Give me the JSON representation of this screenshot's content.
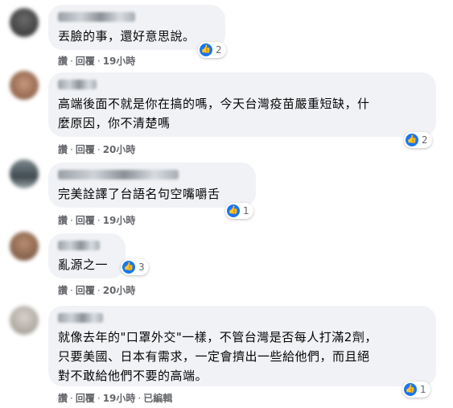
{
  "comments": [
    {
      "text": "丟臉的事，還好意思說。",
      "reaction_count": "2",
      "actions": {
        "like": "讚",
        "reply": "回覆",
        "time": "19小時"
      }
    },
    {
      "text": "高端後面不就是你在搞的嗎，今天台灣疫苗嚴重短缺，什\n麼原因，你不清楚嗎",
      "reaction_count": "2",
      "actions": {
        "like": "讚",
        "reply": "回覆",
        "time": "20小時"
      }
    },
    {
      "text": "完美詮譯了台語名句空嘴嚼舌",
      "reaction_count": "1",
      "actions": {
        "like": "讚",
        "reply": "回覆",
        "time": "19小時"
      }
    },
    {
      "text": "亂源之一",
      "reaction_count": "3",
      "actions": {
        "like": "讚",
        "reply": "回覆",
        "time": "20小時"
      }
    },
    {
      "text": "就像去年的\"口罩外交\"一樣，不管台灣是否每人打滿2劑，\n只要美國、日本有需求，一定會擠出一些給他們，而且絕\n對不敢給他們不要的高端。",
      "reaction_count": "1",
      "actions": {
        "like": "讚",
        "reply": "回覆",
        "time": "19小時",
        "edited": "已編輯"
      }
    }
  ],
  "separator": "·",
  "like_glyph": "👍",
  "colors": {
    "bubble": "#f0f2f5",
    "like_blue": "#1877f2",
    "meta_gray": "#65676b"
  }
}
